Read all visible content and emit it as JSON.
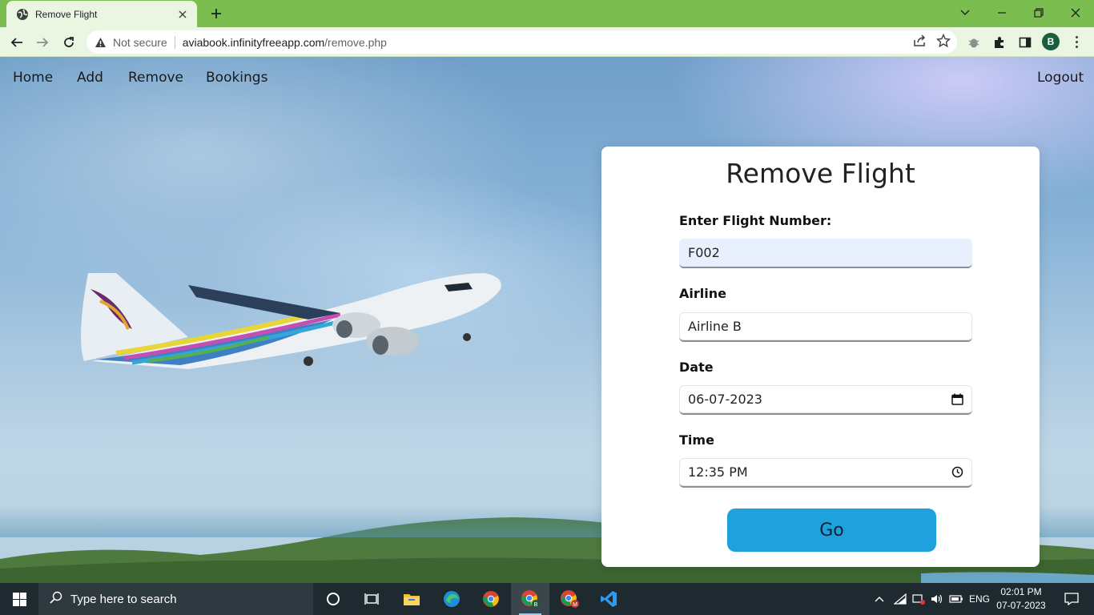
{
  "browser": {
    "tab_title": "Remove Flight",
    "address": {
      "security_label": "Not secure",
      "host": "aviabook.infinityfreeapp.com",
      "path": "/remove.php"
    },
    "profile_initial": "B"
  },
  "nav": {
    "items": [
      {
        "label": "Home"
      },
      {
        "label": "Add"
      },
      {
        "label": "Remove"
      },
      {
        "label": "Bookings"
      }
    ],
    "logout_label": "Logout"
  },
  "form": {
    "title": "Remove Flight",
    "flight_number": {
      "label": "Enter Flight Number:",
      "value": "F002"
    },
    "airline": {
      "label": "Airline",
      "value": "Airline B"
    },
    "date": {
      "label": "Date",
      "value": "06-07-2023"
    },
    "time": {
      "label": "Time",
      "value": "12:35 PM"
    },
    "submit_label": "Go"
  },
  "taskbar": {
    "search_placeholder": "Type here to search",
    "language": "ENG",
    "time": "02:01 PM",
    "date": "07-07-2023"
  },
  "colors": {
    "tab_strip": "#7bbd4e",
    "toolbar": "#eaf6e1",
    "go_button": "#1ea1dc",
    "taskbar": "#1f2a30"
  }
}
